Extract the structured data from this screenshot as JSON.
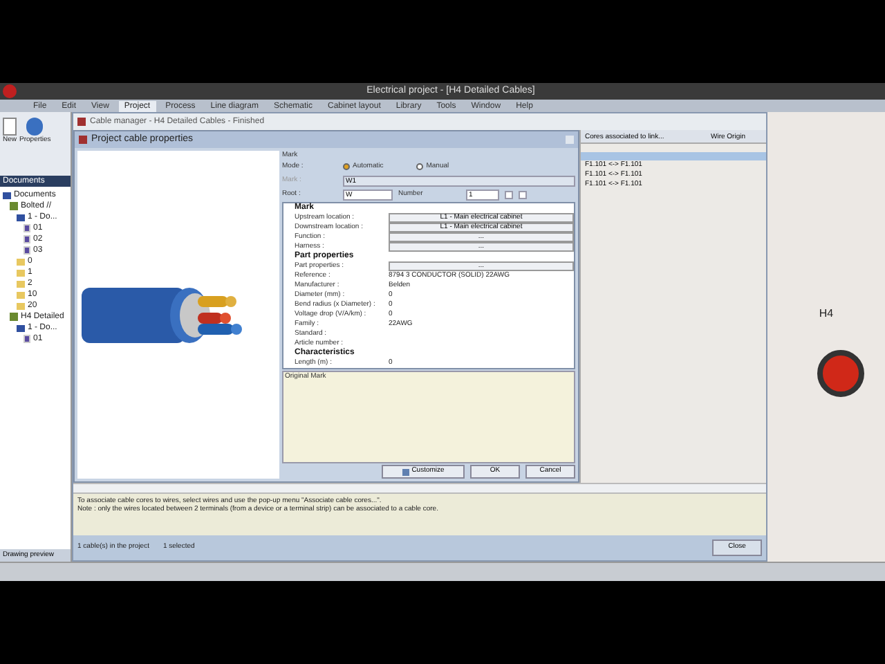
{
  "app": {
    "title": "Electrical project - [H4 Detailed Cables]"
  },
  "ribbon_tabs": [
    {
      "label": "File",
      "selected": false
    },
    {
      "label": "Edit",
      "selected": false
    },
    {
      "label": "View",
      "selected": false
    },
    {
      "label": "Project",
      "selected": true
    },
    {
      "label": "Process",
      "selected": false
    },
    {
      "label": "Line diagram",
      "selected": false
    },
    {
      "label": "Schematic",
      "selected": false
    },
    {
      "label": "Cabinet layout",
      "selected": false
    },
    {
      "label": "Library",
      "selected": false
    },
    {
      "label": "Tools",
      "selected": false
    },
    {
      "label": "Window",
      "selected": false
    },
    {
      "label": "Help",
      "selected": false
    }
  ],
  "ribbon_buttons": [
    {
      "label": "New",
      "kind": "new"
    },
    {
      "label": "Properties",
      "kind": "properties"
    }
  ],
  "documents": {
    "title": "Documents",
    "tree": [
      {
        "label": "Documents",
        "kind": "book",
        "children": [
          {
            "label": "Bolted //",
            "kind": "project",
            "children": [
              {
                "label": "1 - Do...",
                "kind": "book",
                "children": [
                  {
                    "label": "01",
                    "kind": "sheet"
                  },
                  {
                    "label": "02",
                    "kind": "sheet"
                  },
                  {
                    "label": "03",
                    "kind": "sheet"
                  }
                ]
              },
              {
                "label": "0",
                "kind": "folder"
              },
              {
                "label": "1",
                "kind": "folder"
              },
              {
                "label": "2",
                "kind": "folder"
              },
              {
                "label": "10",
                "kind": "folder"
              },
              {
                "label": "20",
                "kind": "folder"
              }
            ]
          },
          {
            "label": "H4 Detailed",
            "kind": "project",
            "children": [
              {
                "label": "1 - Do...",
                "kind": "book",
                "children": [
                  {
                    "label": "01",
                    "kind": "sheet"
                  }
                ]
              }
            ]
          }
        ]
      }
    ]
  },
  "cable_manager": {
    "title": "Cable manager - H4 Detailed Cables - Finished",
    "dialog": {
      "title": "Project cable properties",
      "group": "Mark",
      "mode_label": "Mode :",
      "modes": [
        {
          "label": "Automatic",
          "selected": true
        },
        {
          "label": "Manual",
          "selected": false
        }
      ],
      "mark_label": "Mark :",
      "mark_value": "W1",
      "root_label": "Root :",
      "root_value": "W",
      "number_label": "Number",
      "number_value": "1",
      "properties": [
        {
          "kind": "section",
          "label": "Mark"
        },
        {
          "kind": "field",
          "label": "Upstream location :",
          "value": "L1 - Main electrical cabinet"
        },
        {
          "kind": "field",
          "label": "Downstream location :",
          "value": "L1 - Main electrical cabinet"
        },
        {
          "kind": "field",
          "label": "Function :",
          "value": "..."
        },
        {
          "kind": "field",
          "label": "Harness :",
          "value": "..."
        },
        {
          "kind": "section",
          "label": "Part properties"
        },
        {
          "kind": "field",
          "label": "Part properties :",
          "value": "..."
        },
        {
          "kind": "text",
          "label": "Reference :",
          "value": "8794   3 CONDUCTOR (SOLID) 22AWG"
        },
        {
          "kind": "text",
          "label": "Manufacturer :",
          "value": "Belden"
        },
        {
          "kind": "text",
          "label": "Diameter (mm) :",
          "value": "0"
        },
        {
          "kind": "text",
          "label": "Bend radius (x Diameter) :",
          "value": "0"
        },
        {
          "kind": "text",
          "label": "Voltage drop (V/A/km) :",
          "value": "0"
        },
        {
          "kind": "text",
          "label": "Family :",
          "value": "22AWG"
        },
        {
          "kind": "text",
          "label": "Standard :"
        },
        {
          "kind": "text",
          "label": "Article number :"
        },
        {
          "kind": "section",
          "label": "Characteristics"
        },
        {
          "kind": "text",
          "label": "Length (m) :",
          "value": "0"
        }
      ],
      "notes_label": "Original Mark",
      "buttons": [
        {
          "label": "Customize",
          "kind": "customize"
        },
        {
          "label": "OK",
          "kind": "plain"
        },
        {
          "label": "Cancel",
          "kind": "plain"
        }
      ]
    },
    "list": {
      "columns": [
        "Cores associated to link...",
        "Wire Origin"
      ],
      "rows": [
        {
          "label": "F1.101 <-> F1.101",
          "selected": false
        },
        {
          "label": "F1.101 <-> F1.101",
          "selected": false
        },
        {
          "label": "F1.101 <-> F1.101",
          "selected": false
        }
      ]
    },
    "message": [
      "To associate cable cores to wires, select wires and use the pop-up menu \"Associate cable cores...\".",
      "Note : only the wires located between 2 terminals (from a device or a terminal strip) can be associated to a cable core."
    ],
    "status": [
      "1 cable(s) in the project",
      "1 selected"
    ],
    "close_button": "Close"
  },
  "schematic": {
    "label": "H4"
  },
  "bottom_tab": "Drawing preview"
}
